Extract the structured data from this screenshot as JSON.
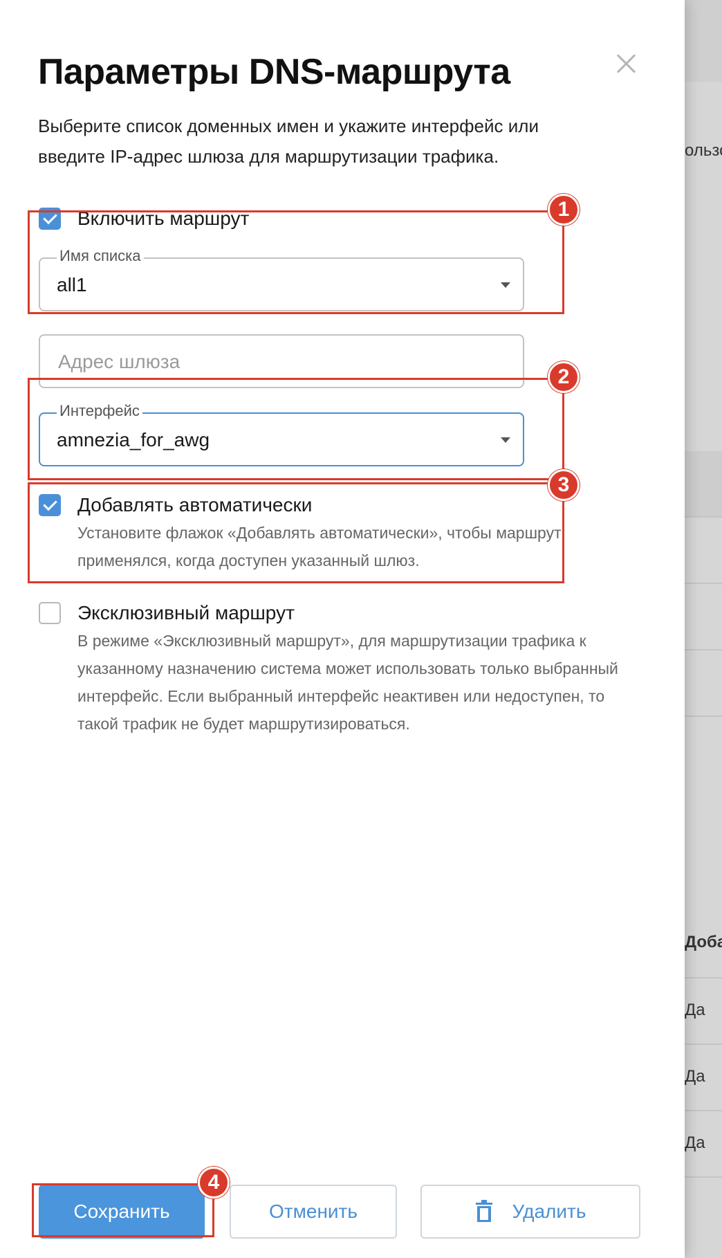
{
  "dialog": {
    "title": "Параметры DNS-маршрута",
    "description": "Выберите список доменных имен и укажите интерфейс или введите IP-адрес шлюза для маршрутизации трафика.",
    "close_icon": "close-icon"
  },
  "enable_route": {
    "label": "Включить маршрут",
    "checked": true
  },
  "list_name": {
    "label": "Имя списка",
    "value": "all1"
  },
  "gateway": {
    "placeholder": "Адрес шлюза"
  },
  "interface": {
    "label": "Интерфейс",
    "value": "amnezia_for_awg"
  },
  "auto_add": {
    "label": "Добавлять автоматически",
    "checked": true,
    "help": "Установите флажок «Добавлять автоматически», чтобы маршрут применялся, когда доступен указанный шлюз."
  },
  "exclusive": {
    "label": "Эксклюзивный маршрут",
    "checked": false,
    "help": "В режиме «Эксклюзивный маршрут», для маршрутизации трафика к указанному назначению система может использовать только выбранный интерфейс. Если выбранный интерфейс неактивен или недоступен, то такой трафик не будет маршрутизироваться."
  },
  "buttons": {
    "save": "Сохранить",
    "cancel": "Отменить",
    "delete": "Удалить",
    "delete_icon": "trash-icon"
  },
  "annotations": [
    "1",
    "2",
    "3",
    "4"
  ],
  "background": {
    "header_fragment": "ользо",
    "column_header": "Доба",
    "rows": [
      "Да",
      "Да",
      "Да"
    ]
  },
  "colors": {
    "accent": "#4a95dc",
    "annotation": "#d93a2b"
  }
}
